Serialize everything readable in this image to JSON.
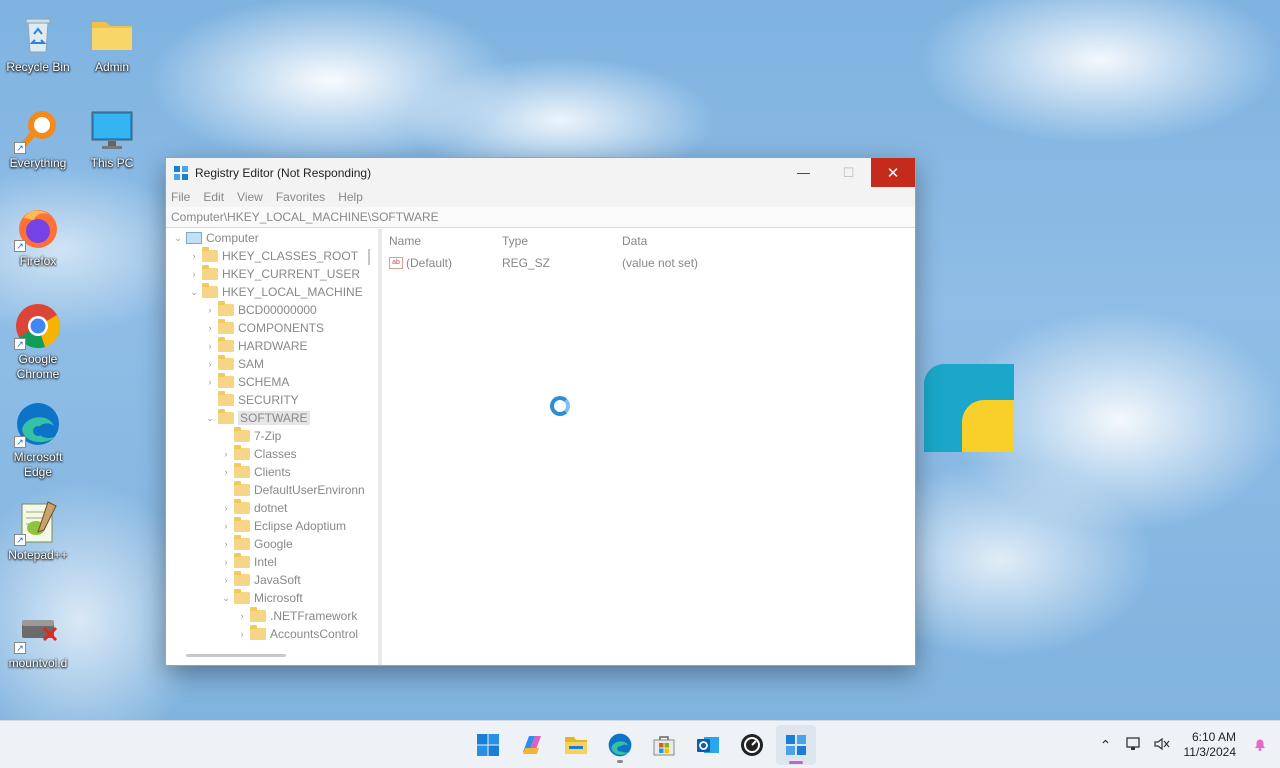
{
  "desktop": {
    "icons": [
      {
        "label": "Recycle Bin"
      },
      {
        "label": "Admin"
      },
      {
        "label": "Everything"
      },
      {
        "label": "This PC"
      },
      {
        "label": "Firefox"
      },
      {
        "label": "Google Chrome"
      },
      {
        "label": "Microsoft Edge"
      },
      {
        "label": "Notepad++"
      },
      {
        "label": "mountvol.d"
      }
    ]
  },
  "window": {
    "title": "Registry Editor (Not Responding)",
    "controls": {
      "minimize": "—",
      "maximize": "☐",
      "close": "✕"
    },
    "menu": [
      "File",
      "Edit",
      "View",
      "Favorites",
      "Help"
    ],
    "address": "Computer\\HKEY_LOCAL_MACHINE\\SOFTWARE",
    "tree": [
      {
        "label": "Computer",
        "chevron": "⌄"
      },
      {
        "label": "HKEY_CLASSES_ROOT",
        "chevron": "›"
      },
      {
        "label": "HKEY_CURRENT_USER",
        "chevron": "›"
      },
      {
        "label": "HKEY_LOCAL_MACHINE",
        "chevron": "⌄"
      },
      {
        "label": "BCD00000000",
        "chevron": "›"
      },
      {
        "label": "COMPONENTS",
        "chevron": "›"
      },
      {
        "label": "HARDWARE",
        "chevron": "›"
      },
      {
        "label": "SAM",
        "chevron": "›"
      },
      {
        "label": "SCHEMA",
        "chevron": "›"
      },
      {
        "label": "SECURITY",
        "chevron": ""
      },
      {
        "label": "SOFTWARE",
        "chevron": "⌄"
      },
      {
        "label": "7-Zip",
        "chevron": ""
      },
      {
        "label": "Classes",
        "chevron": "›"
      },
      {
        "label": "Clients",
        "chevron": "›"
      },
      {
        "label": "DefaultUserEnvironn",
        "chevron": ""
      },
      {
        "label": "dotnet",
        "chevron": "›"
      },
      {
        "label": "Eclipse Adoptium",
        "chevron": "›"
      },
      {
        "label": "Google",
        "chevron": "›"
      },
      {
        "label": "Intel",
        "chevron": "›"
      },
      {
        "label": "JavaSoft",
        "chevron": "›"
      },
      {
        "label": "Microsoft",
        "chevron": "⌄"
      },
      {
        "label": ".NETFramework",
        "chevron": "›"
      },
      {
        "label": "AccountsControl",
        "chevron": "›"
      }
    ],
    "values": {
      "headers": {
        "name": "Name",
        "type": "Type",
        "data": "Data"
      },
      "rows": [
        {
          "icon": "ab",
          "name": "(Default)",
          "type": "REG_SZ",
          "data": "(value not set)"
        }
      ]
    }
  },
  "taskbar": {
    "apps": [
      "windows-start",
      "copilot",
      "file-explorer",
      "edge",
      "microsoft-store",
      "outlook",
      "system-monitor",
      "registry-editor"
    ],
    "tray": {
      "chevron": "⌃",
      "time": "6:10 AM",
      "date": "11/3/2024"
    }
  },
  "colors": {
    "accent": "#2b8fd6",
    "close": "#c42b1c",
    "folder": "#f5d686"
  }
}
